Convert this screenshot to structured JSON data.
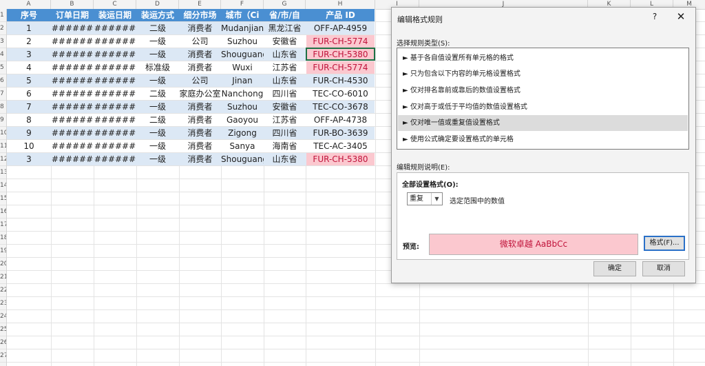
{
  "spreadsheet": {
    "columns": [
      "A",
      "B",
      "C",
      "D",
      "E",
      "F",
      "G",
      "H",
      "I",
      "J",
      "K",
      "L",
      "M"
    ],
    "row_numbers": [
      "1",
      "2",
      "3",
      "4",
      "5",
      "6",
      "7",
      "8",
      "9",
      "10",
      "11",
      "12",
      "13",
      "14",
      "15",
      "16",
      "17",
      "18",
      "19",
      "20",
      "21",
      "22",
      "23",
      "24",
      "25",
      "26",
      "27"
    ],
    "header": [
      "序号",
      "订单日期",
      "装运日期",
      "装运方式",
      "细分市场",
      "城市（Ci",
      "省/市/自",
      "产品 ID"
    ],
    "rows": [
      [
        "1",
        "######",
        "######",
        "二级",
        "消费者",
        "Mudanjiang",
        "黑龙江省",
        "OFF-AP-4959"
      ],
      [
        "2",
        "######",
        "######",
        "一级",
        "公司",
        "Suzhou",
        "安徽省",
        "FUR-CH-5774"
      ],
      [
        "3",
        "######",
        "######",
        "一级",
        "消费者",
        "Shouguang",
        "山东省",
        "FUR-CH-5380"
      ],
      [
        "4",
        "######",
        "######",
        "标准级",
        "消费者",
        "Wuxi",
        "江苏省",
        "FUR-CH-5774"
      ],
      [
        "5",
        "######",
        "######",
        "一级",
        "公司",
        "Jinan",
        "山东省",
        "FUR-CH-4530"
      ],
      [
        "6",
        "######",
        "######",
        "二级",
        "家庭办公室",
        "Nanchong",
        "四川省",
        "TEC-CO-6010"
      ],
      [
        "7",
        "######",
        "######",
        "一级",
        "消费者",
        "Suzhou",
        "安徽省",
        "TEC-CO-3678"
      ],
      [
        "8",
        "######",
        "######",
        "二级",
        "消费者",
        "Gaoyou",
        "江苏省",
        "OFF-AP-4738"
      ],
      [
        "9",
        "######",
        "######",
        "一级",
        "消费者",
        "Zigong",
        "四川省",
        "FUR-BO-3639"
      ],
      [
        "10",
        "######",
        "######",
        "一级",
        "消费者",
        "Sanya",
        "海南省",
        "TEC-AC-3405"
      ],
      [
        "3",
        "######",
        "######",
        "一级",
        "消费者",
        "Shouguang",
        "山东省",
        "FUR-CH-5380"
      ]
    ],
    "duplicate_rows": [
      1,
      2,
      3,
      10
    ],
    "colors": {
      "header_bg": "#4a8fd2",
      "band_bg": "#dce8f5",
      "dup_fill": "#fbc8cf",
      "dup_text": "#c0123a"
    }
  },
  "dialog": {
    "title": "编辑格式规则",
    "help": "?",
    "close": "✕",
    "rule_type_label": "选择规则类型(S):",
    "rule_types": [
      "► 基于各自值设置所有单元格的格式",
      "► 只为包含以下内容的单元格设置格式",
      "► 仅对排名靠前或靠后的数值设置格式",
      "► 仅对高于或低于平均值的数值设置格式",
      "► 仅对唯一值或重复值设置格式",
      "► 使用公式确定要设置格式的单元格"
    ],
    "selected_rule_index": 4,
    "description_label": "编辑规则说明(E):",
    "format_all_label": "全部设置格式(O):",
    "dup_select_value": "重复",
    "range_text": "选定范围中的数值",
    "preview_label": "预览:",
    "preview_text": "微软卓越  AaBbCc",
    "format_button": "格式(F)...",
    "ok_button": "确定",
    "cancel_button": "取消"
  }
}
